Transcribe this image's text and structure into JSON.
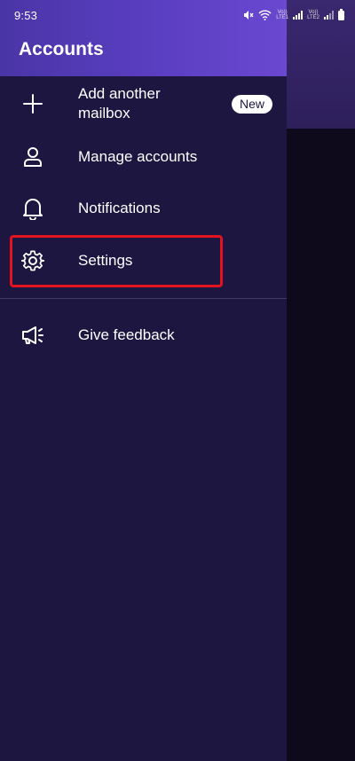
{
  "status_bar": {
    "time": "9:53",
    "sim1_line1": "Vo))",
    "sim1_line2": "LTE1",
    "sim2_line1": "Vo))",
    "sim2_line2": "LTE2"
  },
  "drawer": {
    "title": "Accounts",
    "items": [
      {
        "label_line1": "Add another",
        "label_line2": "mailbox",
        "badge": "New",
        "icon": "plus-icon"
      },
      {
        "label": "Manage accounts",
        "icon": "person-icon"
      },
      {
        "label": "Notifications",
        "icon": "bell-icon"
      },
      {
        "label": "Settings",
        "icon": "gear-icon"
      },
      {
        "label": "Give feedback",
        "icon": "megaphone-icon"
      }
    ]
  },
  "colors": {
    "drawer_bg": "#1c1640",
    "header_gradient_start": "#4a35a6",
    "header_gradient_end": "#6a48d0",
    "highlight": "#e0131e",
    "text": "#ffffff"
  }
}
